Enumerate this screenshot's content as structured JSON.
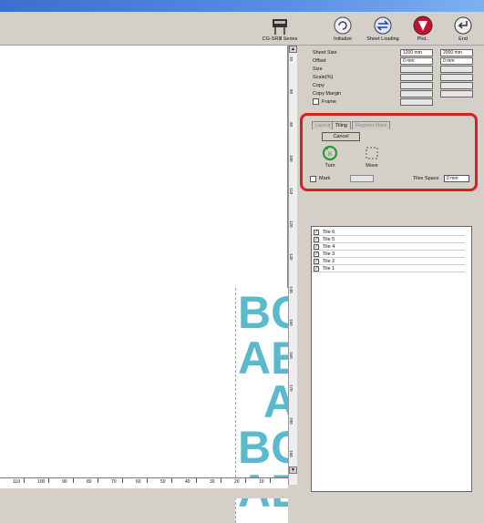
{
  "toolbar": {
    "series_label": "CG-SRⅢ Series",
    "initialize_label": "Initialize",
    "sheet_loading_label": "Sheet Loading",
    "plot_label": "Plot..",
    "end_label": "End"
  },
  "properties": {
    "sheet_size": {
      "label": "Sheet Size",
      "w": "1200 mm",
      "h": "2000 mm"
    },
    "offset": {
      "label": "Offset",
      "w": "0 mm",
      "h": "0 mm"
    },
    "size": {
      "label": "Size",
      "w": "",
      "h": ""
    },
    "scale": {
      "label": "Scale(%)",
      "w": "",
      "h": ""
    },
    "copy": {
      "label": "Copy",
      "w": "",
      "h": ""
    },
    "copy_margin": {
      "label": "Copy Margin",
      "w": "",
      "h": ""
    },
    "frame": {
      "label": "Frame",
      "w": "",
      "h": ""
    }
  },
  "tiling": {
    "tabs": [
      "Layout",
      "Tiling",
      "Register Mark"
    ],
    "active_tab": "Tiling",
    "cancel_label": "Cancel",
    "turn_label": "Turn",
    "move_label": "Move",
    "mark_label": "Mark",
    "mark_value": "",
    "tiles_space_label": "Tiles Space",
    "tiles_space_value": "0 mm"
  },
  "tiles": [
    "Tile 6",
    "Tile 5",
    "Tile 4",
    "Tile 3",
    "Tile 2",
    "Tile 1"
  ],
  "hruler_labels": [
    "110",
    "100",
    "90",
    "80",
    "70",
    "60",
    "50",
    "40",
    "30",
    "20",
    "10"
  ],
  "vruler_labels": [
    "70",
    "80",
    "90",
    "100",
    "110",
    "120",
    "130",
    "140",
    "150",
    "160",
    "170",
    "180",
    "190"
  ],
  "preview_text": [
    "BC",
    "AB",
    "A",
    "BC",
    "AB"
  ],
  "colors": {
    "highlight": "#d81e1e",
    "preview": "#5ab9cc",
    "titlebar": "#3b6fd1"
  }
}
